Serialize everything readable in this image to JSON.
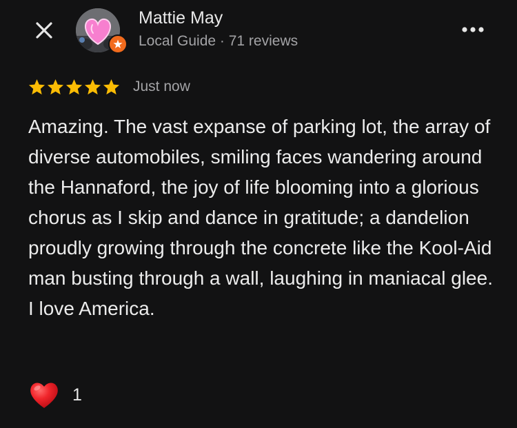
{
  "reviewer": {
    "name": "Mattie May",
    "meta": "Local Guide · 71 reviews",
    "avatar_icon": "heart-sticker-avatar",
    "badge_icon": "local-guide-star-icon",
    "badge_color": "#f26b1d"
  },
  "header": {
    "close_icon": "close-icon",
    "more_icon": "more-options-icon"
  },
  "rating": {
    "stars": 5,
    "max_stars": 5,
    "star_color": "#fbbc04",
    "time": "Just now"
  },
  "review": {
    "text": "Amazing. The vast expanse of parking lot, the array of diverse automobiles, smiling faces wandering around the Hannaford, the joy of life blooming into a glorious chorus as I skip and dance in gratitude; a dandelion proudly growing through the concrete like the Kool-Aid man busting through a wall, laughing in maniacal glee. I love America."
  },
  "reactions": {
    "icon": "red-heart-icon",
    "count": "1"
  },
  "colors": {
    "background": "#121213",
    "secondary_text": "#a3a3a6"
  }
}
